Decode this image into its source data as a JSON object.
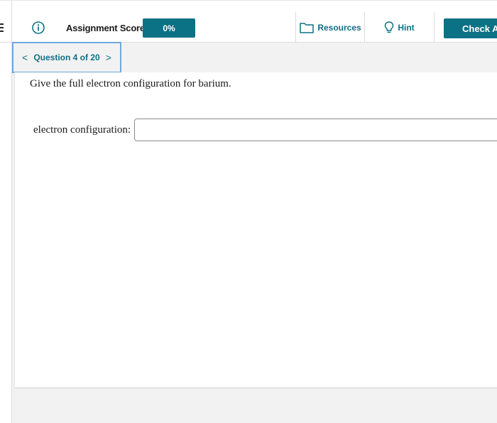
{
  "header": {
    "score_label": "Assignment Score:",
    "score_value": "0%",
    "resources_label": "Resources",
    "hint_label": "Hint",
    "check_answer_label": "Check Answer"
  },
  "icons": {
    "info": "info-circle-icon",
    "resources": "folder-icon",
    "hint": "lightbulb-icon",
    "menu": "menu-icon",
    "prev": "chevron-left-icon",
    "next": "chevron-right-icon"
  },
  "navigation": {
    "question_label": "Question 4 of 20",
    "prev_glyph": "<",
    "next_glyph": ">"
  },
  "question": {
    "prompt": "Give the full electron configuration for barium.",
    "field_label": "electron configuration:",
    "field_value": "",
    "field_placeholder": ""
  },
  "colors": {
    "accent": "#0b7285",
    "focus_border": "#6fa8dc",
    "background": "#f2f2f2"
  }
}
